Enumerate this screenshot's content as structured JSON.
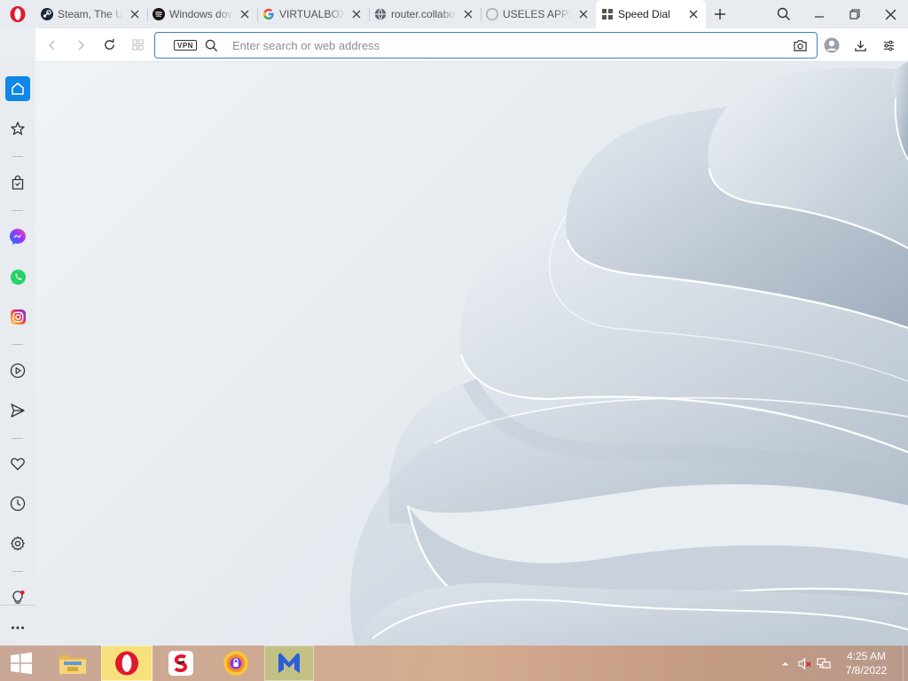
{
  "browser": {
    "tabs": [
      {
        "title": "Steam, The Ultimate Online Game Platform",
        "favicon": "steam-icon"
      },
      {
        "title": "Windows download",
        "favicon": "spotify-icon"
      },
      {
        "title": "VIRTUALBOX",
        "favicon": "google-icon"
      },
      {
        "title": "router.collabora",
        "favicon": "globe-icon"
      },
      {
        "title": "USELES APPS",
        "favicon": "github-icon"
      },
      {
        "title": "Speed Dial",
        "favicon": "speed-dial-icon",
        "active": true
      }
    ],
    "address_bar": {
      "vpn_label": "VPN",
      "placeholder": "Enter search or web address",
      "value": ""
    }
  },
  "sidebar": {
    "items": [
      "home-icon",
      "pinboard-icon",
      "shopping-icon",
      "messenger-icon",
      "whatsapp-icon",
      "instagram-icon",
      "player-icon",
      "send-icon",
      "bookmarks-icon",
      "history-icon",
      "settings-icon",
      "tips-icon",
      "more-icon"
    ]
  },
  "taskbar": {
    "apps": [
      "file-explorer-icon",
      "opera-icon",
      "app-s-icon",
      "vpn-shield-icon",
      "malwarebytes-icon"
    ],
    "clock": {
      "time": "4:25 AM",
      "date": "7/8/2022"
    }
  },
  "colors": {
    "accent": "#0f86e8",
    "opera_red": "#e0192d",
    "address_border": "#3b82c4"
  }
}
